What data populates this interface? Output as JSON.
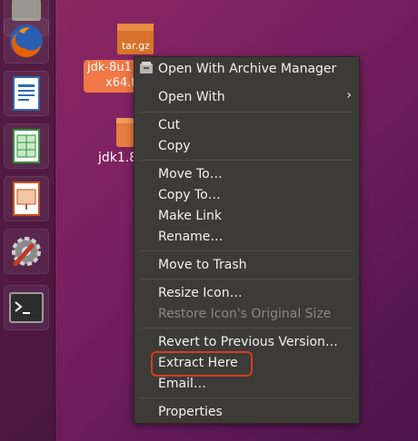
{
  "desktop": {
    "archive_icon_text": "tar.gz",
    "archive_label_line1": "jdk-8u1",
    "archive_label_line2": "x64.t",
    "folder_label": "jdk1.8"
  },
  "launcher": {
    "icons": [
      "firefox-icon",
      "writer-icon",
      "calc-icon",
      "impress-icon",
      "settings-icon",
      "terminal-icon"
    ]
  },
  "menu": {
    "items": [
      {
        "label": "Open With Archive Manager",
        "enabled": true
      },
      {
        "label": "Open With",
        "enabled": true,
        "submenu": true
      },
      {
        "label": "Cut",
        "enabled": true
      },
      {
        "label": "Copy",
        "enabled": true
      },
      {
        "label": "Move To…",
        "enabled": true
      },
      {
        "label": "Copy To…",
        "enabled": true
      },
      {
        "label": "Make Link",
        "enabled": true
      },
      {
        "label": "Rename…",
        "enabled": true
      },
      {
        "label": "Move to Trash",
        "enabled": true
      },
      {
        "label": "Resize Icon…",
        "enabled": true
      },
      {
        "label": "Restore Icon's Original Size",
        "enabled": false
      },
      {
        "label": "Revert to Previous Version…",
        "enabled": true
      },
      {
        "label": "Extract Here",
        "enabled": true
      },
      {
        "label": "Email…",
        "enabled": true
      },
      {
        "label": "Properties",
        "enabled": true
      }
    ],
    "submenu_arrow": "›"
  },
  "colors": {
    "menu_bg": "#3c3b37",
    "menu_text": "#f2f1ef",
    "highlight": "#d93a22",
    "selection": "#f07746"
  }
}
